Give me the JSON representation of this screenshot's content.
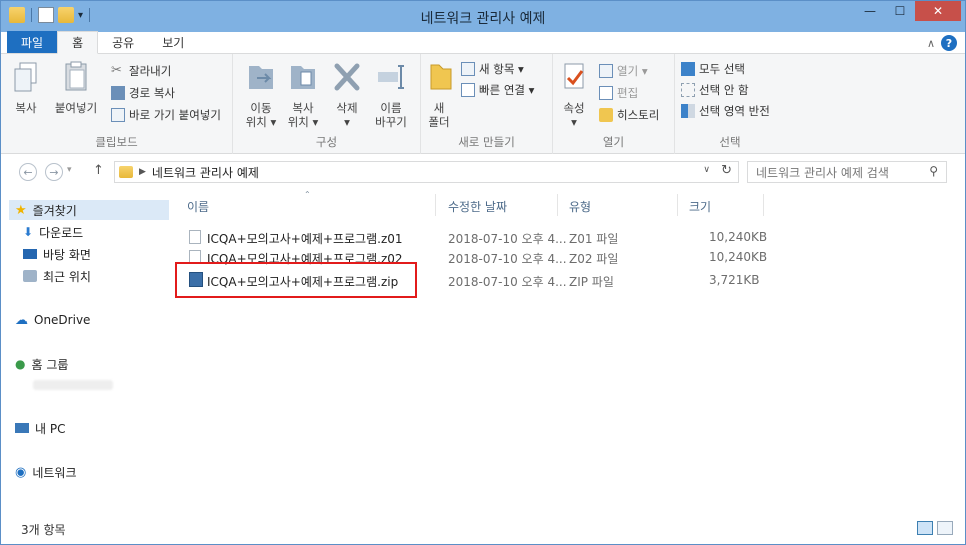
{
  "window": {
    "title": "네트워크 관리사 예제"
  },
  "winbuttons": {
    "minimize": "—",
    "maximize": "☐",
    "close": "✕"
  },
  "tabs": [
    "파일",
    "홈",
    "공유",
    "보기"
  ],
  "ribbon": {
    "clipboard": {
      "copy": "복사",
      "paste": "붙여넣기",
      "cut": "잘라내기",
      "copy_path": "경로 복사",
      "paste_shortcut": "바로 가기 붙여넣기",
      "label": "클립보드"
    },
    "organize": {
      "move_to_1": "이동",
      "move_to_2": "위치 ▾",
      "copy_to_1": "복사",
      "copy_to_2": "위치 ▾",
      "delete_1": "삭제",
      "delete_2": "▾",
      "rename_1": "이름",
      "rename_2": "바꾸기",
      "label": "구성"
    },
    "new": {
      "new_folder_1": "새",
      "new_folder_2": "폴더",
      "new_item": "새 항목 ▾",
      "easy_access": "빠른 연결 ▾",
      "label": "새로 만들기"
    },
    "open": {
      "properties_1": "속성",
      "properties_2": "▾",
      "open": "열기 ▾",
      "edit": "편집",
      "history": "히스토리",
      "label": "열기"
    },
    "select": {
      "select_all": "모두 선택",
      "select_none": "선택 안 함",
      "invert": "선택 영역 반전",
      "label": "선택"
    }
  },
  "address": {
    "path": "네트워크 관리사 예제",
    "search_placeholder": "네트워크 관리사 예제 검색"
  },
  "sidebar": {
    "favorites": "즐겨찾기",
    "downloads": "다운로드",
    "desktop": "바탕 화면",
    "recent": "최근 위치",
    "onedrive": "OneDrive",
    "homegroup": "홈 그룹",
    "pc": "내 PC",
    "network": "네트워크"
  },
  "columns": {
    "name": "이름",
    "date": "수정한 날짜",
    "type": "유형",
    "size": "크기"
  },
  "files": [
    {
      "name": "ICQA+모의고사+예제+프로그램.z01",
      "date": "2018-07-10 오후 4...",
      "type": "Z01 파일",
      "size": "10,240KB"
    },
    {
      "name": "ICQA+모의고사+예제+프로그램.z02",
      "date": "2018-07-10 오후 4...",
      "type": "Z02 파일",
      "size": "10,240KB"
    },
    {
      "name": "ICQA+모의고사+예제+프로그램.zip",
      "date": "2018-07-10 오후 4...",
      "type": "ZIP 파일",
      "size": "3,721KB"
    }
  ],
  "status": {
    "count": "3개 항목"
  }
}
